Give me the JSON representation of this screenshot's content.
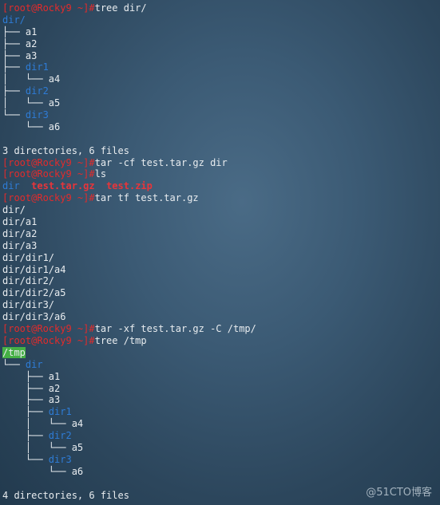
{
  "terminal": {
    "lines": [
      [
        [
          "prompt",
          "[root@Rocky9 ~]#"
        ],
        [
          "text",
          "tree dir/"
        ]
      ],
      [
        [
          "dir",
          "dir/"
        ]
      ],
      [
        [
          "tree",
          "├── "
        ],
        [
          "text",
          "a1"
        ]
      ],
      [
        [
          "tree",
          "├── "
        ],
        [
          "text",
          "a2"
        ]
      ],
      [
        [
          "tree",
          "├── "
        ],
        [
          "text",
          "a3"
        ]
      ],
      [
        [
          "tree",
          "├── "
        ],
        [
          "dir",
          "dir1"
        ]
      ],
      [
        [
          "tree",
          "│   └── "
        ],
        [
          "text",
          "a4"
        ]
      ],
      [
        [
          "tree",
          "├── "
        ],
        [
          "dir",
          "dir2"
        ]
      ],
      [
        [
          "tree",
          "│   └── "
        ],
        [
          "text",
          "a5"
        ]
      ],
      [
        [
          "tree",
          "└── "
        ],
        [
          "dir",
          "dir3"
        ]
      ],
      [
        [
          "tree",
          "    └── "
        ],
        [
          "text",
          "a6"
        ]
      ],
      [
        [
          "text",
          ""
        ]
      ],
      [
        [
          "text",
          "3 directories, 6 files"
        ]
      ],
      [
        [
          "prompt",
          "[root@Rocky9 ~]#"
        ],
        [
          "text",
          "tar -cf test.tar.gz dir"
        ]
      ],
      [
        [
          "prompt",
          "[root@Rocky9 ~]#"
        ],
        [
          "text",
          "ls"
        ]
      ],
      [
        [
          "dir",
          "dir"
        ],
        [
          "text",
          "  "
        ],
        [
          "archive",
          "test.tar.gz"
        ],
        [
          "text",
          "  "
        ],
        [
          "archive",
          "test.zip"
        ]
      ],
      [
        [
          "prompt",
          "[root@Rocky9 ~]#"
        ],
        [
          "text",
          "tar tf test.tar.gz"
        ]
      ],
      [
        [
          "text",
          "dir/"
        ]
      ],
      [
        [
          "text",
          "dir/a1"
        ]
      ],
      [
        [
          "text",
          "dir/a2"
        ]
      ],
      [
        [
          "text",
          "dir/a3"
        ]
      ],
      [
        [
          "text",
          "dir/dir1/"
        ]
      ],
      [
        [
          "text",
          "dir/dir1/a4"
        ]
      ],
      [
        [
          "text",
          "dir/dir2/"
        ]
      ],
      [
        [
          "text",
          "dir/dir2/a5"
        ]
      ],
      [
        [
          "text",
          "dir/dir3/"
        ]
      ],
      [
        [
          "text",
          "dir/dir3/a6"
        ]
      ],
      [
        [
          "prompt",
          "[root@Rocky9 ~]#"
        ],
        [
          "text",
          "tar -xf test.tar.gz -C /tmp/"
        ]
      ],
      [
        [
          "prompt",
          "[root@Rocky9 ~]#"
        ],
        [
          "text",
          "tree /tmp"
        ]
      ],
      [
        [
          "hl",
          "/tmp"
        ]
      ],
      [
        [
          "tree",
          "└── "
        ],
        [
          "dir",
          "dir"
        ]
      ],
      [
        [
          "tree",
          "    ├── "
        ],
        [
          "text",
          "a1"
        ]
      ],
      [
        [
          "tree",
          "    ├── "
        ],
        [
          "text",
          "a2"
        ]
      ],
      [
        [
          "tree",
          "    ├── "
        ],
        [
          "text",
          "a3"
        ]
      ],
      [
        [
          "tree",
          "    ├── "
        ],
        [
          "dir",
          "dir1"
        ]
      ],
      [
        [
          "tree",
          "    │   └── "
        ],
        [
          "text",
          "a4"
        ]
      ],
      [
        [
          "tree",
          "    ├── "
        ],
        [
          "dir",
          "dir2"
        ]
      ],
      [
        [
          "tree",
          "    │   └── "
        ],
        [
          "text",
          "a5"
        ]
      ],
      [
        [
          "tree",
          "    └── "
        ],
        [
          "dir",
          "dir3"
        ]
      ],
      [
        [
          "tree",
          "        └── "
        ],
        [
          "text",
          "a6"
        ]
      ],
      [
        [
          "text",
          ""
        ]
      ],
      [
        [
          "text",
          "4 directories, 6 files"
        ]
      ]
    ]
  },
  "watermark": "@51CTO博客",
  "colors": {
    "prompt": "#e32b2b",
    "directory": "#2e7cd6",
    "archive": "#e8353a",
    "highlight_bg": "#45b045",
    "text": "#e8ecef",
    "background": "#3b5a74"
  }
}
